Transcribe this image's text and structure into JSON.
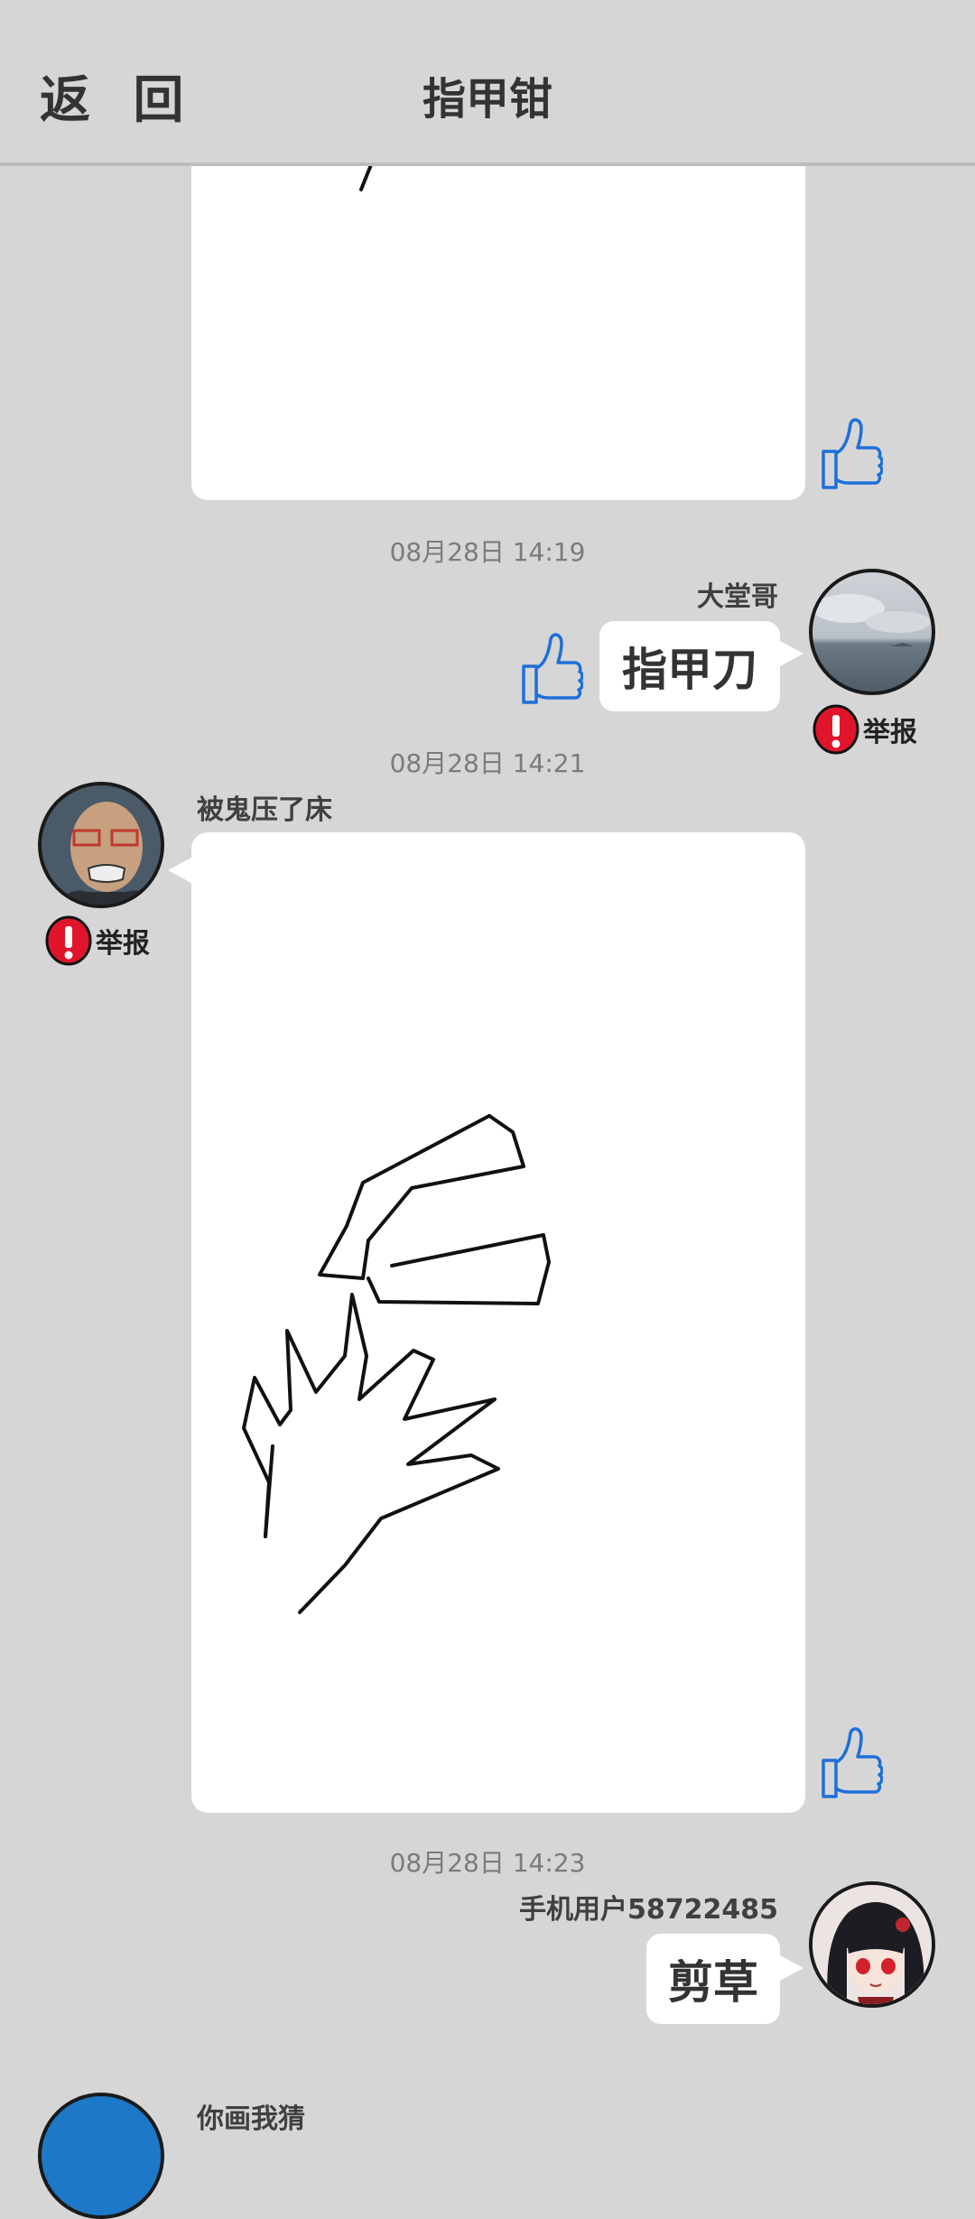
{
  "header": {
    "back_label": "返 回",
    "title": "指甲钳"
  },
  "colors": {
    "background": "#d6d6d6",
    "like_blue": "#1e6fd9",
    "report_red": "#e0152b"
  },
  "messages": [
    {
      "type": "drawing",
      "side": "left",
      "partial": true
    },
    {
      "timestamp": "08月28日  14:19",
      "author": "大堂哥",
      "side": "right",
      "text": "指甲刀",
      "report": "举报"
    },
    {
      "timestamp": "08月28日  14:21",
      "author": "被鬼压了床",
      "side": "left",
      "type": "drawing",
      "report": "举报"
    },
    {
      "timestamp": "08月28日  14:23",
      "author": "手机用户58722485",
      "side": "right",
      "text": "剪草"
    },
    {
      "author": "你画我猜",
      "side": "left",
      "partial": true
    }
  ],
  "icons": {
    "like": "thumbs-up-icon",
    "report": "exclamation-icon"
  }
}
